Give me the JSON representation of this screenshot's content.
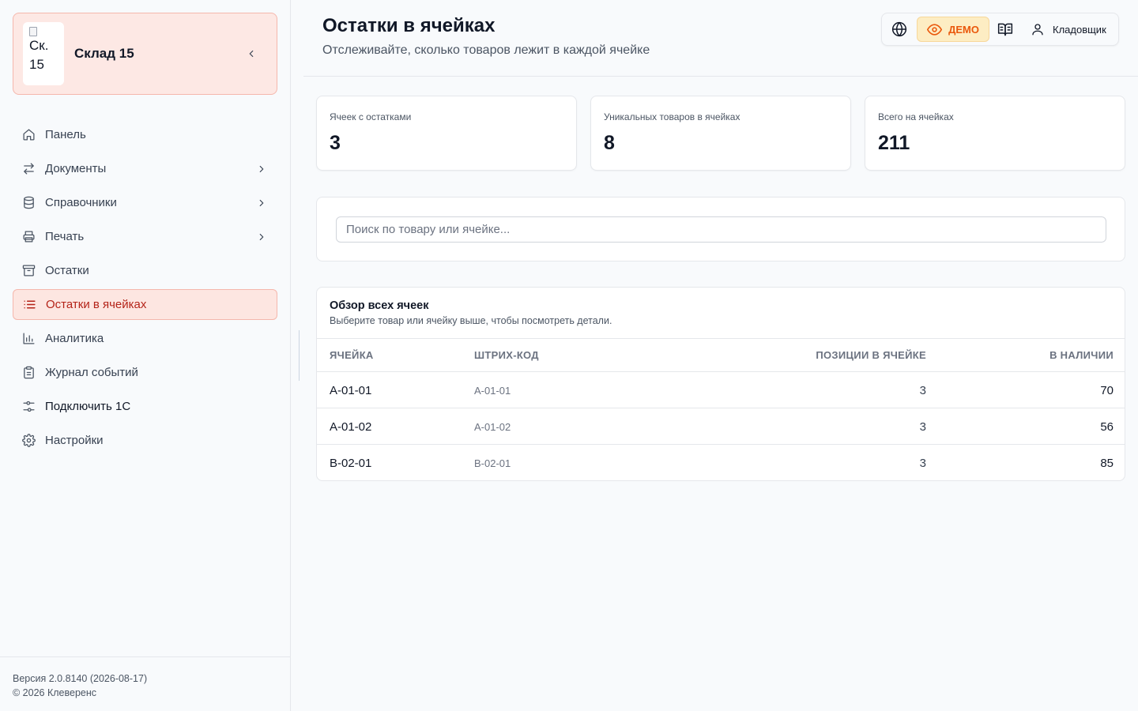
{
  "brand": {
    "logo_alt": "Ск. 15",
    "title": "Склад 15"
  },
  "nav": [
    {
      "label": "Панель",
      "icon": "home-icon",
      "chevron": false,
      "active": false
    },
    {
      "label": "Документы",
      "icon": "arrows-swap-icon",
      "chevron": true,
      "active": false
    },
    {
      "label": "Справочники",
      "icon": "database-icon",
      "chevron": true,
      "active": false
    },
    {
      "label": "Печать",
      "icon": "printer-icon",
      "chevron": true,
      "active": false
    },
    {
      "label": "Остатки",
      "icon": "archive-icon",
      "chevron": false,
      "active": false
    },
    {
      "label": "Остатки в ячейках",
      "icon": "list-icon",
      "chevron": false,
      "active": true
    },
    {
      "label": "Аналитика",
      "icon": "bar-chart-icon",
      "chevron": false,
      "active": false
    },
    {
      "label": "Журнал событий",
      "icon": "clipboard-icon",
      "chevron": false,
      "active": false
    },
    {
      "label": "Подключить 1С",
      "icon": "sliders-icon",
      "chevron": false,
      "active": false
    },
    {
      "label": "Настройки",
      "icon": "gear-icon",
      "chevron": false,
      "active": false
    }
  ],
  "footer": {
    "version": "Версия 2.0.8140 (2026-08-17)",
    "copyright": "© 2026 Клеверенс"
  },
  "header": {
    "title": "Остатки в ячейках",
    "subtitle": "Отслеживайте, сколько товаров лежит в каждой ячейке",
    "demo_label": "ДЕМО",
    "user_label": "Кладовщик"
  },
  "stats": [
    {
      "label": "Ячеек с остатками",
      "value": "3"
    },
    {
      "label": "Уникальных товаров в ячейках",
      "value": "8"
    },
    {
      "label": "Всего на ячейках",
      "value": "211"
    }
  ],
  "search": {
    "placeholder": "Поиск по товару или ячейке..."
  },
  "table": {
    "title": "Обзор всех ячеек",
    "subtitle": "Выберите товар или ячейку выше, чтобы посмотреть детали.",
    "columns": [
      "ЯЧЕЙКА",
      "ШТРИХ-КОД",
      "ПОЗИЦИИ В ЯЧЕЙКЕ",
      "В НАЛИЧИИ"
    ],
    "rows": [
      {
        "cell": "A-01-01",
        "barcode": "A-01-01",
        "positions": "3",
        "stock": "70"
      },
      {
        "cell": "A-01-02",
        "barcode": "A-01-02",
        "positions": "3",
        "stock": "56"
      },
      {
        "cell": "B-02-01",
        "barcode": "B-02-01",
        "positions": "3",
        "stock": "85"
      }
    ]
  },
  "colors": {
    "accent": "#b42318",
    "accent_bg": "#fde6e1",
    "demo": "#ea580c",
    "demo_bg": "#fdedc3"
  }
}
